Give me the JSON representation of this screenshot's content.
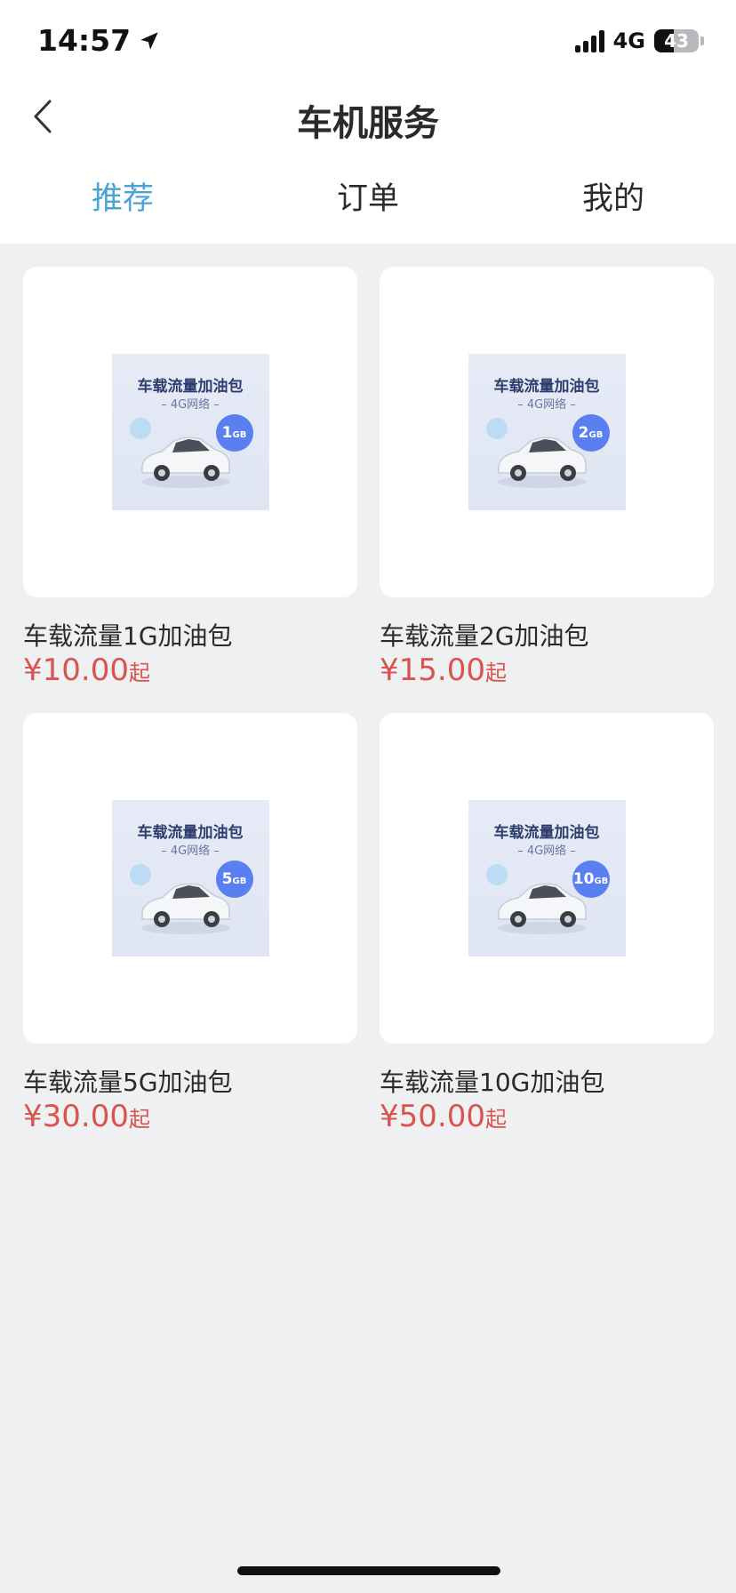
{
  "status_bar": {
    "time": "14:57",
    "network": "4G",
    "battery": "43"
  },
  "nav": {
    "title": "车机服务"
  },
  "tabs": [
    {
      "label": "推荐",
      "active": true
    },
    {
      "label": "订单",
      "active": false
    },
    {
      "label": "我的",
      "active": false
    }
  ],
  "products": [
    {
      "thumb_title": "车载流量加油包",
      "thumb_sub": "– 4G网络 –",
      "badge_num": "1",
      "badge_unit": "GB",
      "name": "车载流量1G加油包",
      "price": "¥10.00",
      "price_suffix": "起"
    },
    {
      "thumb_title": "车载流量加油包",
      "thumb_sub": "– 4G网络 –",
      "badge_num": "2",
      "badge_unit": "GB",
      "name": "车载流量2G加油包",
      "price": "¥15.00",
      "price_suffix": "起"
    },
    {
      "thumb_title": "车载流量加油包",
      "thumb_sub": "– 4G网络 –",
      "badge_num": "5",
      "badge_unit": "GB",
      "name": "车载流量5G加油包",
      "price": "¥30.00",
      "price_suffix": "起"
    },
    {
      "thumb_title": "车载流量加油包",
      "thumb_sub": "– 4G网络 –",
      "badge_num": "10",
      "badge_unit": "GB",
      "name": "车载流量10G加油包",
      "price": "¥50.00",
      "price_suffix": "起"
    }
  ],
  "colors": {
    "accent_tab": "#4aa3d2",
    "price": "#d9534f",
    "page_bg": "#eff0f2",
    "badge": "#5a7ff0"
  },
  "icons": {
    "back": "chevron-left-icon",
    "location": "location-arrow-icon"
  }
}
